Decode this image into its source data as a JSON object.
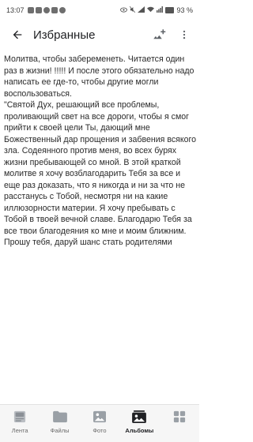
{
  "status_bar": {
    "time": "13:07",
    "battery": "93 %",
    "battery_level": 0.93
  },
  "app_bar": {
    "title": "Избранные"
  },
  "note": {
    "text": "Молитва, чтобы забеременеть. Читается один раз в жизни! !!!!! И после этого обязательно надо написать ее где-то, чтобы другие могли воспользоваться.\n\"Святой Дух, решающий все проблемы, проливающий свет на все дороги, чтобы я смог прийти к своей цели Ты, дающий мне Божественный дар прощения и забвения всякого зла. Содеянного против меня, во всех бурях жизни пребывающей со мной. В этой краткой молитве я хочу возблагодарить Тебя за все и еще раз доказать, что я никогда и ни за что не расстанусь с Тобой, несмотря ни на какие иллюзорности материи. Я хочу пребывать с Тобой в твоей вечной славе. Благодарю Тебя за все твои благодеяния ко мне и моим ближним. Прошу тебя, даруй шанс стать родителями"
  },
  "bottom_nav": {
    "items": [
      {
        "label": "Лента",
        "icon": "feed-icon",
        "active": false
      },
      {
        "label": "Файлы",
        "icon": "folder-icon",
        "active": false
      },
      {
        "label": "Фото",
        "icon": "photo-icon",
        "active": false
      },
      {
        "label": "Альбомы",
        "icon": "albums-icon",
        "active": true
      },
      {
        "label": "",
        "icon": "apps-icon",
        "active": false
      }
    ]
  },
  "colors": {
    "text": "#2a2a2a",
    "icon": "#5f6368",
    "nav_background": "#f6f6f6"
  }
}
